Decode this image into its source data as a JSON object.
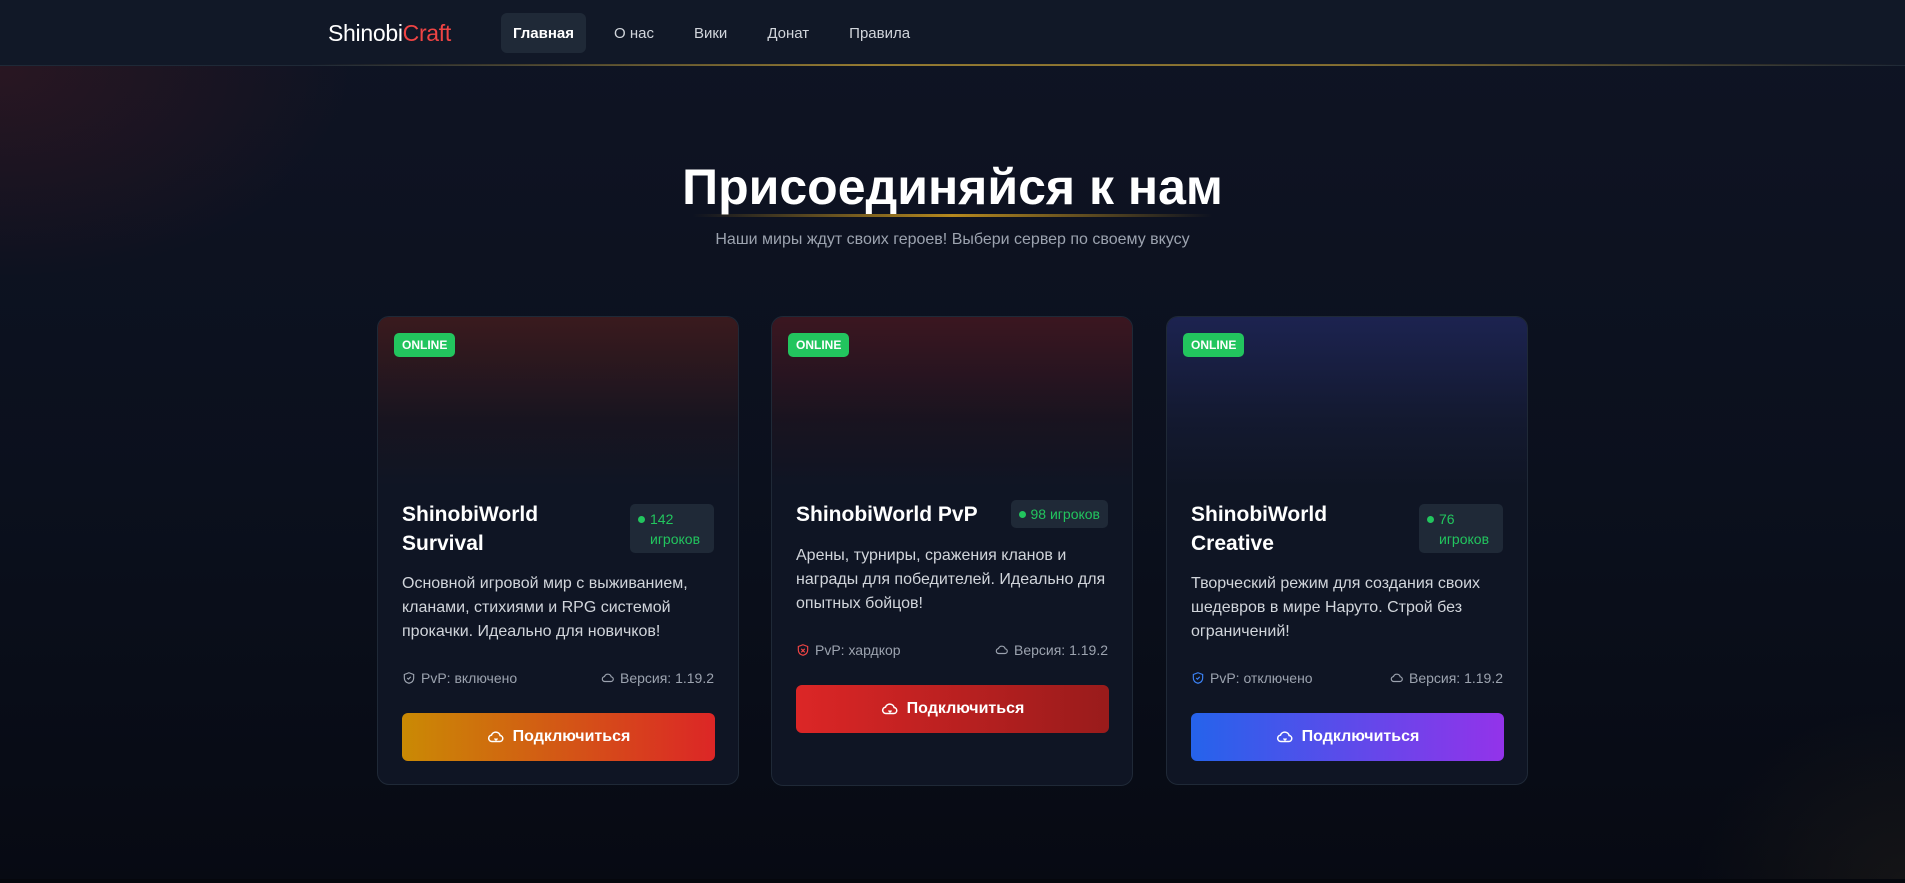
{
  "nav": {
    "logo_part1": "Shinobi",
    "logo_part2": "Craft",
    "items": [
      {
        "label": "Главная",
        "active": true
      },
      {
        "label": "О нас",
        "active": false
      },
      {
        "label": "Вики",
        "active": false
      },
      {
        "label": "Донат",
        "active": false
      },
      {
        "label": "Правила",
        "active": false
      }
    ]
  },
  "hero": {
    "title": "Присоединяйся к нам",
    "subtitle": "Наши миры ждут своих героев! Выбери сервер по своему вкусу"
  },
  "servers": [
    {
      "status": "ONLINE",
      "name": "ShinobiWorld Survival",
      "players_count": "142",
      "players_unit": "игроков",
      "description": "Основной игровой мир с выживанием, кланами, стихиями и RPG системой прокачки. Идеально для новичков!",
      "pvp": "PvP: включено",
      "version": "Версия: 1.19.2",
      "button": "Подключиться",
      "accent": "#ca8a04"
    },
    {
      "status": "ONLINE",
      "name": "ShinobiWorld PvP",
      "players_count": "98",
      "players_unit": "игроков",
      "description": "Арены, турниры, сражения кланов и награды для победителей. Идеально для опытных бойцов!",
      "pvp": "PvP: хардкор",
      "version": "Версия: 1.19.2",
      "button": "Подключиться",
      "accent": "#dc2626"
    },
    {
      "status": "ONLINE",
      "name": "ShinobiWorld Creative",
      "players_count": "76",
      "players_unit": "игроков",
      "description": "Творческий режим для создания своих шедевров в мире Наруто. Строй без ограничений!",
      "pvp": "PvP: отключено",
      "version": "Версия: 1.19.2",
      "button": "Подключиться",
      "accent": "#2563eb"
    }
  ],
  "colors": {
    "online": "#22c55e",
    "brand_red": "#ef4444",
    "background": "#0a0e1a"
  }
}
